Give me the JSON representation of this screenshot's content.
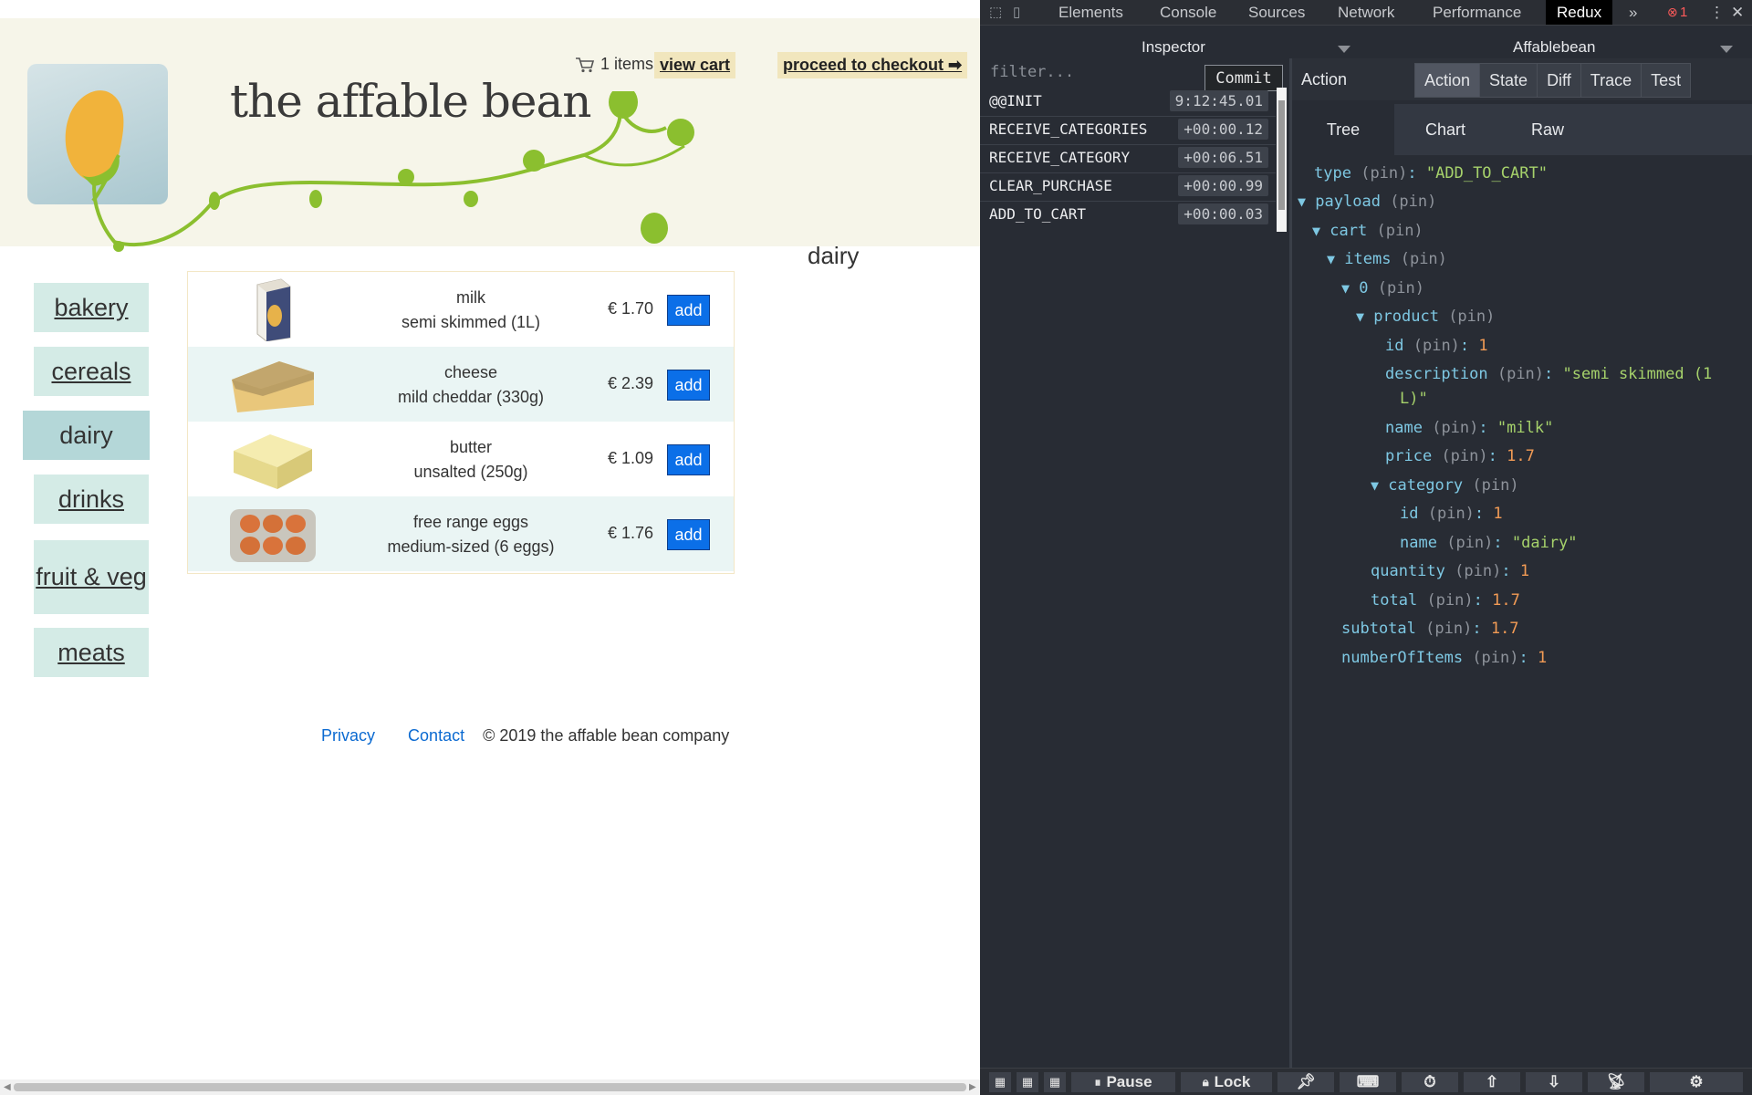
{
  "site": {
    "title": "the affable bean",
    "cart_count_text": "1 items",
    "view_cart": "view cart",
    "checkout": "proceed to checkout ➡",
    "category_heading": "dairy"
  },
  "categories": [
    {
      "label": "bakery",
      "active": false
    },
    {
      "label": "cereals",
      "active": false
    },
    {
      "label": "dairy",
      "active": true
    },
    {
      "label": "drinks",
      "active": false
    },
    {
      "label": "fruit & veg",
      "active": false
    },
    {
      "label": "meats",
      "active": false
    }
  ],
  "products": [
    {
      "name": "milk",
      "desc": "semi skimmed (1L)",
      "price": "€ 1.70",
      "add": "add",
      "image": "milk-carton"
    },
    {
      "name": "cheese",
      "desc": "mild cheddar (330g)",
      "price": "€ 2.39",
      "add": "add",
      "image": "cheese-wedge"
    },
    {
      "name": "butter",
      "desc": "unsalted (250g)",
      "price": "€ 1.09",
      "add": "add",
      "image": "butter-block"
    },
    {
      "name": "free range eggs",
      "desc": "medium-sized (6 eggs)",
      "price": "€ 1.76",
      "add": "add",
      "image": "egg-carton"
    }
  ],
  "footer": {
    "privacy": "Privacy",
    "contact": "Contact",
    "copyright": "© 2019 the affable bean company"
  },
  "devtools": {
    "tabs": [
      "Elements",
      "Console",
      "Sources",
      "Network",
      "Performance",
      "Redux"
    ],
    "active_tab": "Redux",
    "more": "»",
    "error_count": "1",
    "monitor": "Inspector",
    "instance": "Affablebean",
    "filter_placeholder": "filter...",
    "commit": "Commit",
    "actions": [
      {
        "name": "@@INIT",
        "time": "9:12:45.01"
      },
      {
        "name": "RECEIVE_CATEGORIES",
        "time": "+00:00.12"
      },
      {
        "name": "RECEIVE_CATEGORY",
        "time": "+00:06.51"
      },
      {
        "name": "CLEAR_PURCHASE",
        "time": "+00:00.99"
      },
      {
        "name": "ADD_TO_CART",
        "time": "+00:00.03"
      }
    ],
    "panel_title": "Action",
    "panel_tabs": [
      "Action",
      "State",
      "Diff",
      "Trace",
      "Test"
    ],
    "panel_active": "Action",
    "sub_tabs": [
      "Tree",
      "Chart",
      "Raw"
    ],
    "sub_active": "Tree",
    "pin": "(pin)",
    "tree": {
      "type_key": "type",
      "type_val": "\"ADD_TO_CART\"",
      "payload": "payload",
      "cart": "cart",
      "items": "items",
      "index": "0",
      "product": "product",
      "id_key": "id",
      "id_val": "1",
      "desc_key": "description",
      "desc_val1": "\"semi skimmed (1",
      "desc_val2": "L)\"",
      "name_key": "name",
      "name_val": "\"milk\"",
      "price_key": "price",
      "price_val": "1.7",
      "category": "category",
      "cat_id_key": "id",
      "cat_id_val": "1",
      "cat_name_key": "name",
      "cat_name_val": "\"dairy\"",
      "qty_key": "quantity",
      "qty_val": "1",
      "total_key": "total",
      "total_val": "1.7",
      "subtotal_key": "subtotal",
      "subtotal_val": "1.7",
      "noi_key": "numberOfItems",
      "noi_val": "1"
    },
    "bottom": {
      "pause": "Pause",
      "lock": "Lock"
    }
  },
  "colors": {
    "accent_blue": "#0b6fe8",
    "header_bg": "#f6f5e9",
    "cat_bg": "#d4ebe6",
    "cat_active_bg": "#b4d7d8",
    "devtools_bg": "#282c34"
  }
}
